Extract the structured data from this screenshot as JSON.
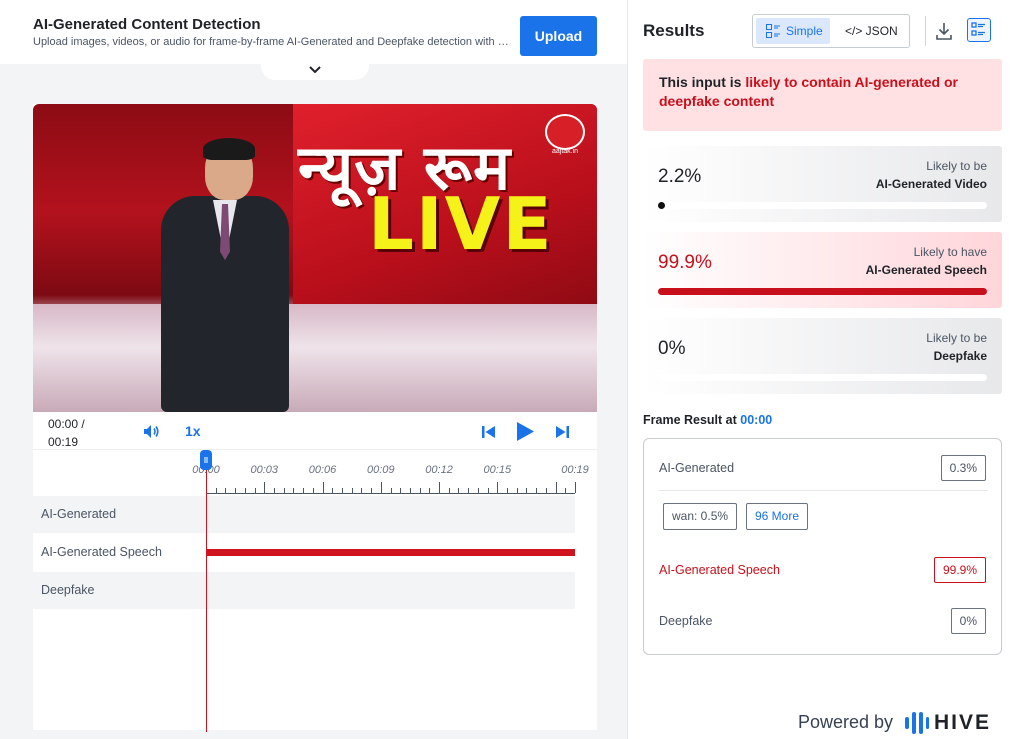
{
  "header": {
    "title": "AI-Generated Content Detection",
    "subtitle": "Upload images, videos, or audio for frame-by-frame AI-Generated and Deepfake detection with Hive's models",
    "upload_label": "Upload"
  },
  "player": {
    "time_current": "00:00 /",
    "time_total": "00:19",
    "speed": "1x",
    "video_caption_hindi": "न्यूज़ रूम",
    "video_caption_live": "LIVE",
    "video_logo_text": "aajtak.in",
    "ticks": [
      "00:00",
      "00:03",
      "00:06",
      "00:09",
      "00:12",
      "00:15",
      "00:19"
    ],
    "tracks": [
      {
        "label": "AI-Generated"
      },
      {
        "label": "AI-Generated Speech"
      },
      {
        "label": "Deepfake"
      }
    ]
  },
  "results": {
    "title": "Results",
    "view_simple": "Simple",
    "view_json": "</> JSON",
    "verdict_prefix": "This input is ",
    "verdict_highlight": "likely to contain AI-generated or deepfake content",
    "cards": [
      {
        "value": "2.2%",
        "line1": "Likely to be",
        "line2": "AI-Generated Video",
        "fraction": 0.022,
        "alert": false
      },
      {
        "value": "99.9%",
        "line1": "Likely to have",
        "line2": "AI-Generated Speech",
        "fraction": 0.999,
        "alert": true
      },
      {
        "value": "0%",
        "line1": "Likely to be",
        "line2": "Deepfake",
        "fraction": 0.0,
        "alert": false
      }
    ],
    "frame_title": "Frame Result at ",
    "frame_time": "00:00",
    "frame": {
      "ai_generated_label": "AI-Generated",
      "ai_generated_value": "0.3%",
      "chip_wan": "wan: 0.5%",
      "chip_more": "96 More",
      "speech_label": "AI-Generated Speech",
      "speech_value": "99.9%",
      "deepfake_label": "Deepfake",
      "deepfake_value": "0%"
    },
    "powered_by": "Powered by",
    "brand": "HIVE"
  },
  "colors": {
    "accent": "#1a73e8",
    "alert": "#c8101c"
  }
}
